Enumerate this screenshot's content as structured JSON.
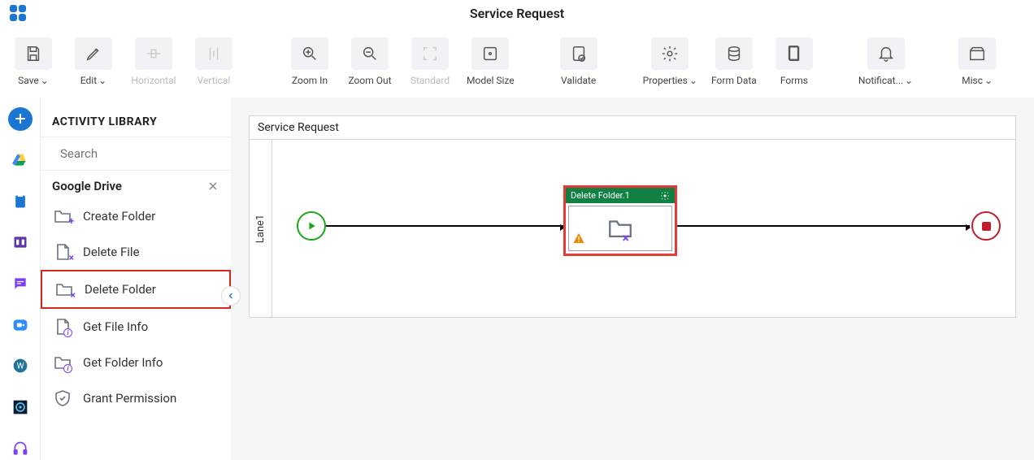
{
  "header": {
    "title": "Service Request"
  },
  "toolbar": [
    {
      "id": "save",
      "label": "Save",
      "chev": true,
      "disabled": false
    },
    {
      "id": "edit",
      "label": "Edit",
      "chev": true,
      "disabled": false
    },
    {
      "id": "horizontal",
      "label": "Horizontal",
      "chev": false,
      "disabled": true
    },
    {
      "id": "vertical",
      "label": "Vertical",
      "chev": false,
      "disabled": true
    },
    {
      "id": "zoomin",
      "label": "Zoom In",
      "chev": false,
      "disabled": false
    },
    {
      "id": "zoomout",
      "label": "Zoom Out",
      "chev": false,
      "disabled": false
    },
    {
      "id": "standard",
      "label": "Standard",
      "chev": false,
      "disabled": true
    },
    {
      "id": "modelsize",
      "label": "Model Size",
      "chev": false,
      "disabled": false
    },
    {
      "id": "validate",
      "label": "Validate",
      "chev": false,
      "disabled": false
    },
    {
      "id": "properties",
      "label": "Properties",
      "chev": true,
      "disabled": false
    },
    {
      "id": "formdata",
      "label": "Form Data",
      "chev": false,
      "disabled": false
    },
    {
      "id": "forms",
      "label": "Forms",
      "chev": false,
      "disabled": false
    },
    {
      "id": "notif",
      "label": "Notificat...",
      "chev": true,
      "disabled": false
    },
    {
      "id": "misc",
      "label": "Misc",
      "chev": true,
      "disabled": false
    }
  ],
  "library": {
    "header": "ACTIVITY LIBRARY",
    "search_placeholder": "Search",
    "group": "Google Drive",
    "items": [
      {
        "label": "Create Folder",
        "icon": "folder",
        "badge": "plus",
        "selected": false
      },
      {
        "label": "Delete File",
        "icon": "file",
        "badge": "x",
        "selected": false
      },
      {
        "label": "Delete Folder",
        "icon": "folder",
        "badge": "x",
        "selected": true
      },
      {
        "label": "Get File Info",
        "icon": "file",
        "badge": "i",
        "selected": false
      },
      {
        "label": "Get Folder Info",
        "icon": "folder",
        "badge": "i",
        "selected": false
      },
      {
        "label": "Grant Permission",
        "icon": "shield",
        "badge": "",
        "selected": false
      }
    ]
  },
  "canvas": {
    "title": "Service Request",
    "lane_label": "Lane1",
    "activity_label": "Delete Folder.1"
  }
}
